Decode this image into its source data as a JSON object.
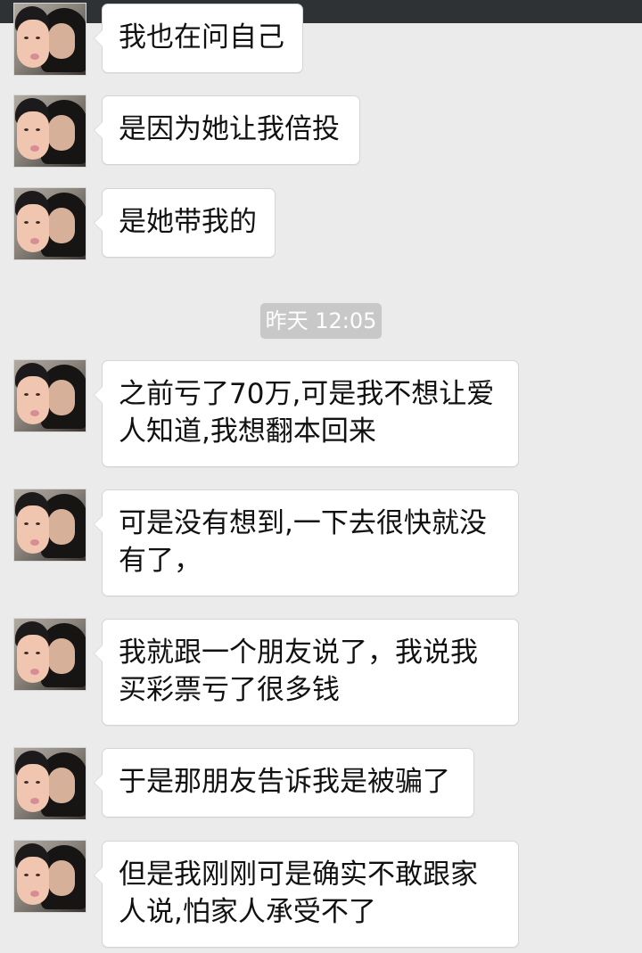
{
  "chat": {
    "timestamp": "昨天 12:05",
    "messages": [
      {
        "text": "我也在问自己"
      },
      {
        "text": "是因为她让我倍投"
      },
      {
        "text": "是她带我的"
      },
      {
        "text": "之前亏了70万,可是我不想让爱\n人知道,我想翻本回来"
      },
      {
        "text": "可是没有想到,一下去很快就没\n有了，"
      },
      {
        "text": "我就跟一个朋友说了，我说我\n买彩票亏了很多钱"
      },
      {
        "text": "于是那朋友告诉我是被骗了"
      },
      {
        "text": "但是我刚刚可是确实不敢跟家\n人说,怕家人承受不了"
      }
    ]
  }
}
